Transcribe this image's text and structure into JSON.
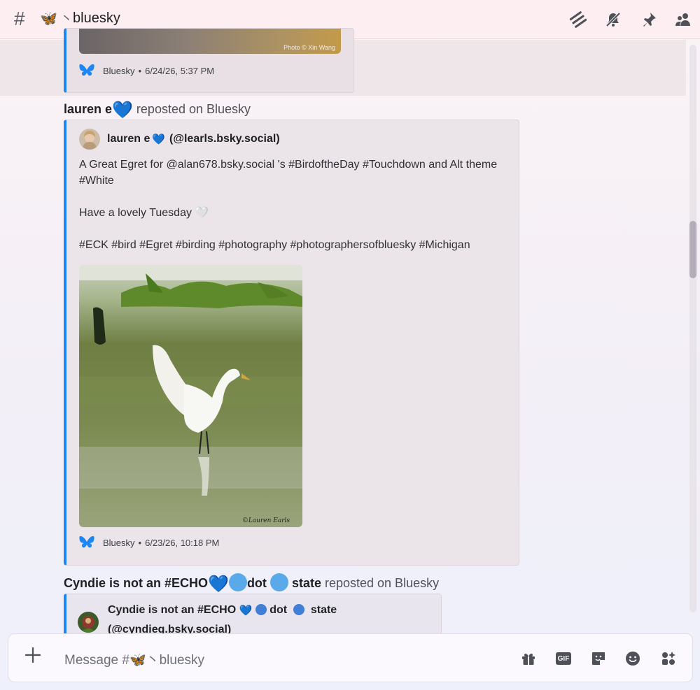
{
  "header": {
    "hash_icon": "#",
    "channel_emoji": "🦋",
    "channel_separator": "丶",
    "channel_name": "bluesky",
    "icons": [
      "threads-icon",
      "mute-icon",
      "pin-icon",
      "members-icon"
    ]
  },
  "messages": [
    {
      "photo_credit": "Photo © Xin Wang",
      "footer": {
        "source": "Bluesky",
        "sep": "•",
        "timestamp": "6/24/26, 5:37 PM"
      }
    },
    {
      "reposter": "lauren e",
      "reposter_emoji": "💙",
      "repost_text": " reposted on Bluesky",
      "author": "lauren e",
      "author_emoji": "💙",
      "handle": "(@learls.bsky.social)",
      "text": "A Great Egret for @alan678.bsky.social 's #BirdoftheDay #Touchdown and Alt theme #White\n\nHave a lovely Tuesday 🤍\n\n#ECK #bird #Egret #birding #photography #photographersofbluesky #Michigan",
      "image_watermark": "©Lauren Earls",
      "footer": {
        "source": "Bluesky",
        "sep": "•",
        "timestamp": "6/23/26, 10:18 PM"
      }
    },
    {
      "reposter": "Cyndie  is not an #ECHO",
      "reposter_tail1": "dot",
      "reposter_tail2": "state",
      "repost_text": " reposted on Bluesky",
      "author": "Cyndie  is not an #ECHO",
      "author_tail1": "dot",
      "author_tail2": "state",
      "handle": "(@cyndieg.bsky.social)"
    }
  ],
  "composer": {
    "placeholder": "Message #🦋丶bluesky",
    "icons": [
      "gift-icon",
      "gif-icon",
      "sticker-icon",
      "emoji-icon",
      "apps-icon"
    ],
    "gif_label": "GIF"
  },
  "colors": {
    "accent": "#1b86f4",
    "heart": "#5aa9e8"
  }
}
